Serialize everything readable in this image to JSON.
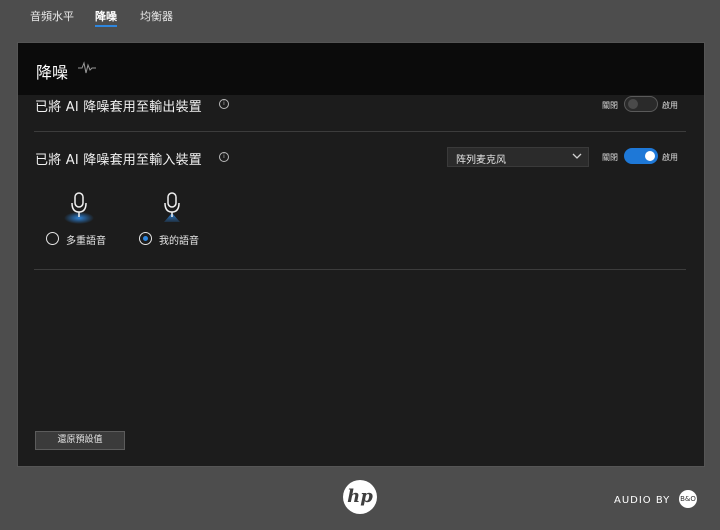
{
  "tabs": [
    {
      "label": "音頻水平"
    },
    {
      "label": "降噪"
    },
    {
      "label": "均衡器"
    }
  ],
  "panel": {
    "title": "降噪",
    "output_row": {
      "label": "已將 AI 降噪套用至輸出裝置",
      "off_label": "關閉",
      "on_label": "啟用",
      "enabled": false
    },
    "input_row": {
      "label": "已將 AI 降噪套用至輸入裝置",
      "device": "阵列麦克风",
      "off_label": "關閉",
      "on_label": "啟用",
      "enabled": true
    },
    "voice_options": [
      {
        "label": "多重語音",
        "selected": false
      },
      {
        "label": "我的語音",
        "selected": true
      }
    ],
    "reset_label": "還原預設值"
  },
  "footer": {
    "hp_logo_text": "hp",
    "audio_by": "AUDIO BY",
    "bo_logo_text": "B&O"
  },
  "colors": {
    "accent": "#1e78d7",
    "background": "#4d4d4d",
    "panel": "#1c1c1c"
  }
}
